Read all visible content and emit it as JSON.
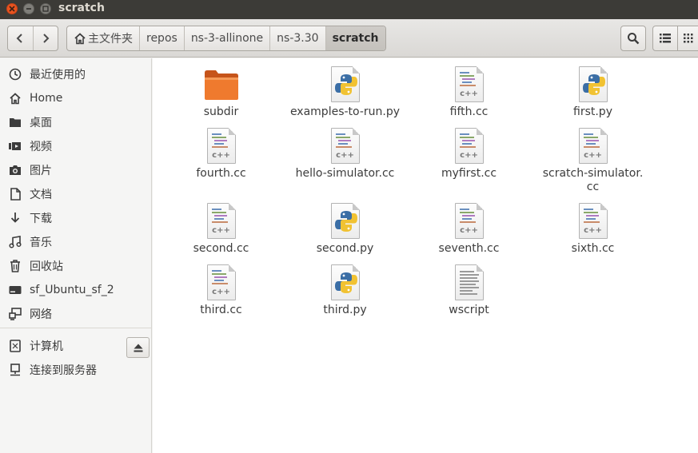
{
  "window": {
    "title": "scratch"
  },
  "toolbar": {
    "breadcrumbs": [
      {
        "label": "主文件夹",
        "icon": "home-icon"
      },
      {
        "label": "repos"
      },
      {
        "label": "ns-3-allinone"
      },
      {
        "label": "ns-3.30"
      },
      {
        "label": "scratch"
      }
    ]
  },
  "sidebar": {
    "items": [
      {
        "label": "最近使用的",
        "icon": "clock-icon"
      },
      {
        "label": "Home",
        "icon": "home-icon"
      },
      {
        "label": "桌面",
        "icon": "desktop-folder-icon"
      },
      {
        "label": "视频",
        "icon": "video-icon"
      },
      {
        "label": "图片",
        "icon": "camera-icon"
      },
      {
        "label": "文档",
        "icon": "document-icon"
      },
      {
        "label": "下载",
        "icon": "download-icon"
      },
      {
        "label": "音乐",
        "icon": "music-icon"
      },
      {
        "label": "回收站",
        "icon": "trash-icon"
      },
      {
        "label": "sf_Ubuntu_sf_2",
        "icon": "drive-icon"
      },
      {
        "label": "网络",
        "icon": "network-icon"
      },
      {
        "label": "计算机",
        "icon": "computer-icon"
      },
      {
        "label": "连接到服务器",
        "icon": "server-icon"
      }
    ]
  },
  "files": [
    {
      "name": "subdir",
      "type": "folder"
    },
    {
      "name": "examples-to-run.py",
      "type": "python"
    },
    {
      "name": "fifth.cc",
      "type": "cpp"
    },
    {
      "name": "first.py",
      "type": "python"
    },
    {
      "name": "fourth.cc",
      "type": "cpp"
    },
    {
      "name": "hello-simulator.cc",
      "type": "cpp"
    },
    {
      "name": "myfirst.cc",
      "type": "cpp"
    },
    {
      "name": "scratch-simulator.\ncc",
      "type": "cpp"
    },
    {
      "name": "second.cc",
      "type": "cpp"
    },
    {
      "name": "second.py",
      "type": "python"
    },
    {
      "name": "seventh.cc",
      "type": "cpp"
    },
    {
      "name": "sixth.cc",
      "type": "cpp"
    },
    {
      "name": "third.cc",
      "type": "cpp"
    },
    {
      "name": "third.py",
      "type": "python"
    },
    {
      "name": "wscript",
      "type": "text"
    }
  ],
  "icons": {
    "cpp_label": "c++"
  },
  "colors": {
    "titlebar": "#3c3b37",
    "close": "#e9541f",
    "folder": "#e9701f",
    "python_blue": "#3b6ea5",
    "python_yellow": "#f1c232"
  }
}
